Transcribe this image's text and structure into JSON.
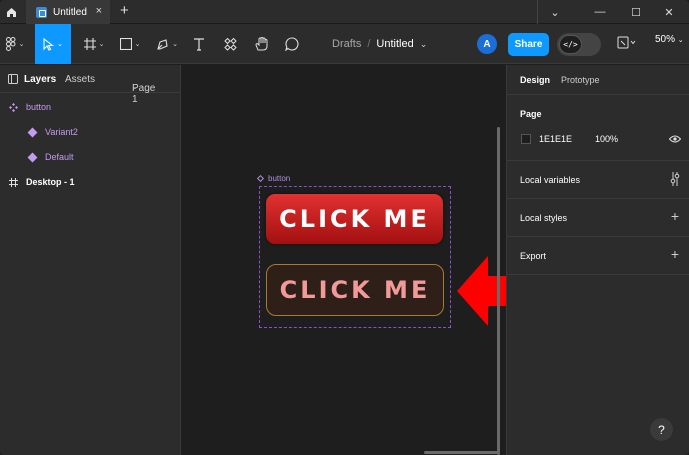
{
  "titlebar": {
    "tab_title": "Untitled",
    "tab_close": "×",
    "new_tab": "+",
    "window_controls": [
      "⌄",
      "—",
      "☐",
      "✕"
    ]
  },
  "toolbar": {
    "breadcrumb_project": "Drafts",
    "breadcrumb_sep": "/",
    "file_title": "Untitled",
    "avatar_initial": "A",
    "share_label": "Share",
    "dev_mode_glyph": "</>",
    "zoom": "50%",
    "tools": [
      "main-menu-icon",
      "move-tool-icon",
      "frame-tool-icon",
      "shape-tool-icon",
      "pen-tool-icon",
      "text-tool-icon",
      "resources-icon",
      "hand-tool-icon",
      "comment-icon"
    ]
  },
  "left_panel": {
    "tab_layers": "Layers",
    "tab_assets": "Assets",
    "page_selector": "Page 1",
    "layers": [
      {
        "name": "button",
        "type": "component-set"
      },
      {
        "name": "Variant2",
        "type": "component"
      },
      {
        "name": "Default",
        "type": "component"
      },
      {
        "name": "Desktop - 1",
        "type": "frame"
      }
    ]
  },
  "canvas": {
    "component_label": "button",
    "button_primary_text": "CLICK ME",
    "button_secondary_text": "CLICK ME"
  },
  "right_panel": {
    "tab_design": "Design",
    "tab_prototype": "Prototype",
    "page_heading": "Page",
    "page_color_hex": "1E1E1E",
    "page_opacity": "100%",
    "local_variables": "Local variables",
    "local_styles": "Local styles",
    "export": "Export",
    "help": "?"
  },
  "colors": {
    "accent": "#0d99ff",
    "component_purple": "#b28ce0",
    "arrow_red": "#ff0000"
  }
}
